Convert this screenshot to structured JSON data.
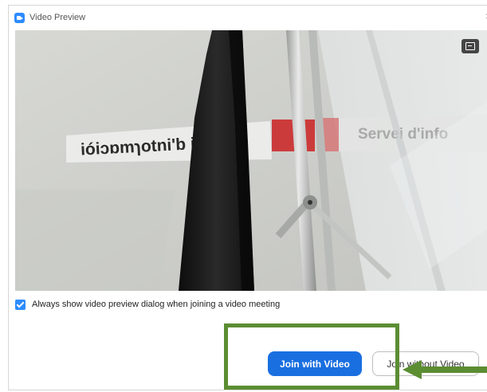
{
  "window": {
    "title": "Video Preview",
    "close_symbol": "×"
  },
  "preview": {
    "sign_left_text": "ióiɔɒmɿotni'b i",
    "sign_right_text": "Servei d'info"
  },
  "options": {
    "always_show_label": "Always show video preview dialog when joining a video meeting",
    "always_show_checked": true
  },
  "buttons": {
    "join_with_video": "Join with Video",
    "join_without_video": "Join without Video"
  },
  "colors": {
    "accent": "#2d8cff",
    "primary_button": "#1a6fe0",
    "annotation": "#5b8d32"
  },
  "icons": {
    "app": "zoom-camera-icon",
    "background": "virtual-background-icon",
    "close": "close-icon",
    "check": "check-icon",
    "annotation_arrow": "arrow-left-icon"
  }
}
